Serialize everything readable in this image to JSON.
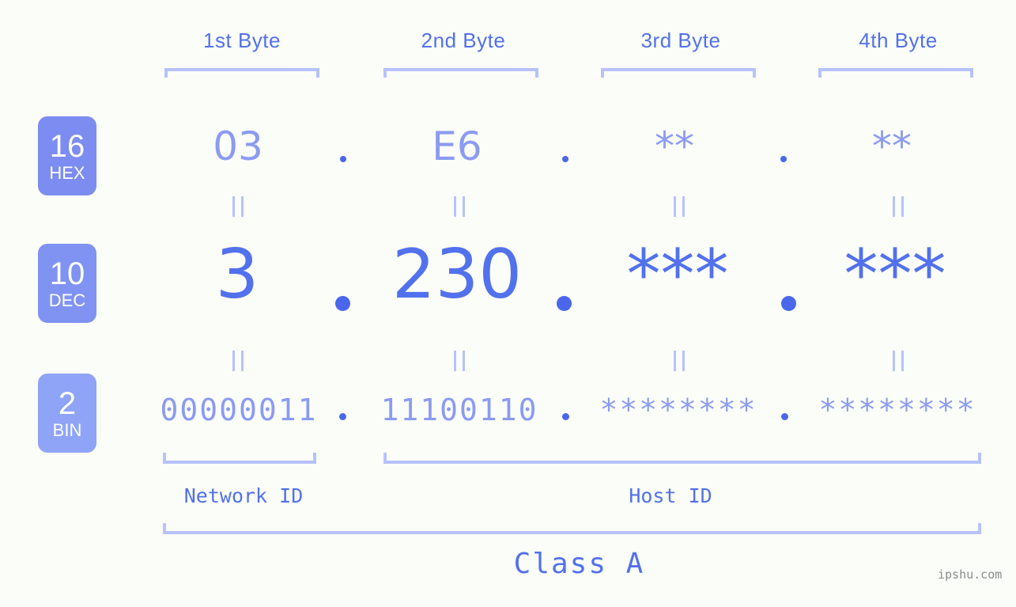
{
  "header": {
    "bytes": [
      {
        "label": "1st Byte"
      },
      {
        "label": "2nd Byte"
      },
      {
        "label": "3rd Byte"
      },
      {
        "label": "4th Byte"
      }
    ]
  },
  "rows": {
    "hex": {
      "badge_num": "16",
      "badge_name": "HEX",
      "values": [
        "03",
        "E6",
        "**",
        "**"
      ],
      "separator": "."
    },
    "dec": {
      "badge_num": "10",
      "badge_name": "DEC",
      "values": [
        "3",
        "230",
        "***",
        "***"
      ],
      "separator": "."
    },
    "bin": {
      "badge_num": "2",
      "badge_name": "BIN",
      "values": [
        "00000011",
        "11100110",
        "********",
        "********"
      ],
      "separator": "."
    }
  },
  "equals_mark": "||",
  "sections": {
    "network_id": "Network ID",
    "host_id": "Host ID",
    "class": "Class A"
  },
  "watermark": "ipshu.com",
  "colors": {
    "background": "#FBFDF8",
    "accent_strong": "#5271ED",
    "accent_light": "#8B9BF2",
    "bracket": "#B7C2FB",
    "badge_hex": "#7C8CF0",
    "badge_dec": "#8093F2",
    "badge_bin": "#8FA4F7",
    "dot": "#4A67EB",
    "watermark": "#8A8A8A"
  }
}
